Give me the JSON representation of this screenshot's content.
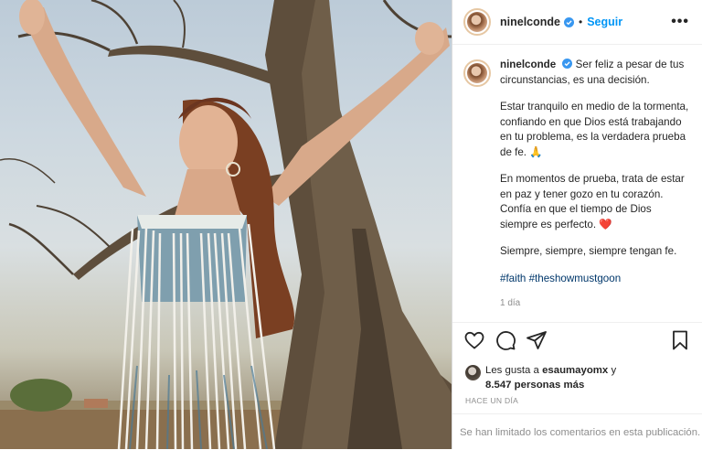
{
  "header": {
    "username": "ninelconde",
    "follow_label": "Seguir",
    "more_label": "•••"
  },
  "caption": {
    "username": "ninelconde",
    "p1": "Ser feliz a pesar de tus circunstancias, es una decisión.",
    "p2": "Estar tranquilo en medio de la tormenta, confiando en que Dios está trabajando en tu problema, es la verdadera prueba de fe. 🙏",
    "p3a": "En momentos de prueba, trata de estar en paz y tener gozo en tu corazón. Confía en que el tiempo de Dios siempre es perfecto.",
    "p3_emoji": "❤️",
    "p4": "Siempre, siempre, siempre tengan fe.",
    "hashtag1": "#faith",
    "hashtag2": "#theshowmustgoon",
    "time": "1 día"
  },
  "likes": {
    "prefix": "Les gusta a",
    "user": "esaumayomx",
    "connector": "y",
    "count": "8.547 personas más"
  },
  "posted_ago": "HACE UN DÍA",
  "comments_notice": "Se han limitado los comentarios en esta publicación.",
  "colors": {
    "accent": "#0095f6",
    "heart": "#e0245e",
    "muted": "#8e8e8e"
  },
  "icons": [
    "verified-badge-icon",
    "heart-icon",
    "comment-icon",
    "share-icon",
    "save-bookmark-icon"
  ]
}
